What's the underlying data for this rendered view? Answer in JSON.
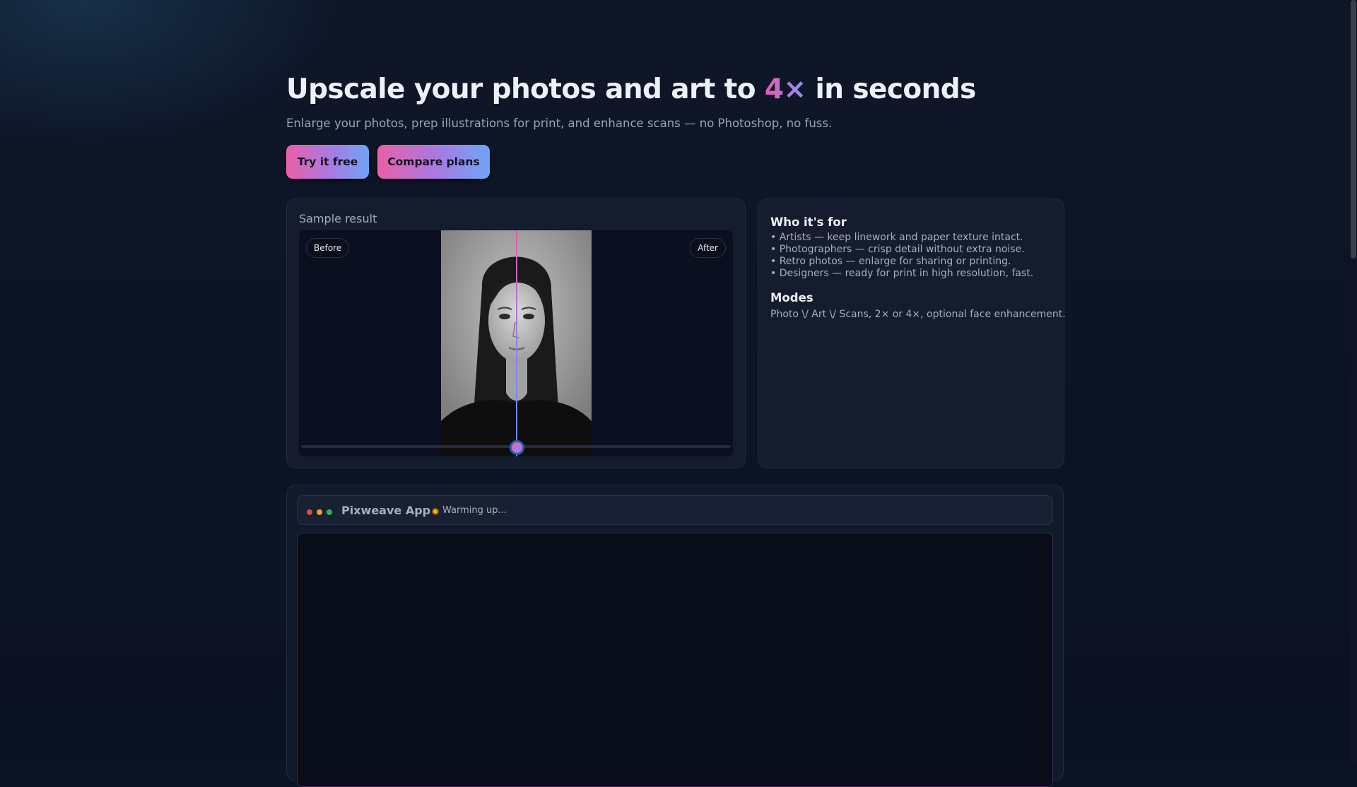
{
  "hero": {
    "title_before": "Upscale your photos and art to ",
    "title_accent": "4×",
    "title_after": " in seconds",
    "subtitle": "Enlarge your photos, prep illustrations for print, and enhance scans — no Photoshop, no fuss.",
    "primary_button": "Try it free",
    "secondary_button": "Compare plans"
  },
  "sample": {
    "label": "Sample result",
    "before_chip": "Before",
    "after_chip": "After",
    "slider_position": 0.5
  },
  "info": {
    "who_title": "Who it's for",
    "who_items": [
      "• Artists — keep linework and paper texture intact.",
      "• Photographers — crisp detail without extra noise.",
      "• Retro photos — enlarge for sharing or printing.",
      "• Designers — ready for print in high resolution, fast."
    ],
    "modes_title": "Modes",
    "modes_text": "Photo \\/ Art \\/ Scans, 2× or 4×, optional face enhancement."
  },
  "app": {
    "title": "Pixweave App",
    "status": "Warming up..."
  },
  "colors": {
    "accent_pink": "#ea5fa7",
    "accent_blue": "#6ea5f8",
    "status_warming": "#f0b51c"
  }
}
